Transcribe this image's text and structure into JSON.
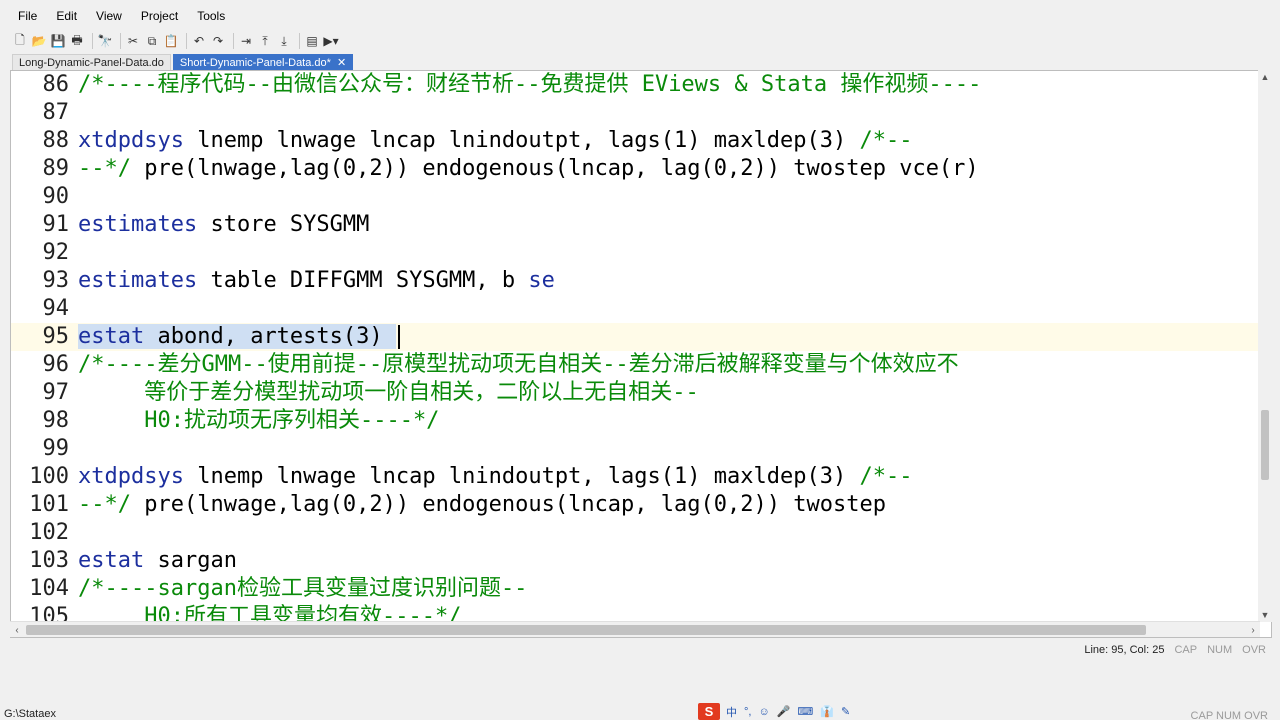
{
  "menu": [
    "File",
    "Edit",
    "View",
    "Project",
    "Tools"
  ],
  "toolbar_icons": [
    "new-file-icon",
    "open-folder-icon",
    "save-icon",
    "print-icon",
    "find-icon",
    "cut-icon",
    "copy-icon",
    "paste-icon",
    "undo-icon",
    "redo-icon",
    "indent-icon",
    "move-up-icon",
    "move-down-icon",
    "run-icon",
    "do-icon"
  ],
  "tabs": [
    {
      "label": "Long-Dynamic-Panel-Data.do",
      "active": false
    },
    {
      "label": "Short-Dynamic-Panel-Data.do*",
      "active": true,
      "close": "✕"
    }
  ],
  "code_lines": [
    {
      "n": "86",
      "text": "/*----程序代码--由微信公众号：财经节析--免费提供 EViews & Stata 操作视频----",
      "cls": "cmt"
    },
    {
      "n": "87",
      "text": ""
    },
    {
      "n": "88",
      "segments": [
        [
          "xtdpdsys",
          "kw"
        ],
        [
          " lnemp lnwage lncap lnindoutpt, lags(1) maxldep(3) ",
          ""
        ],
        [
          "/*--",
          "cmt"
        ]
      ]
    },
    {
      "n": "89",
      "segments": [
        [
          "--*/",
          "cmt"
        ],
        [
          " pre(lnwage,lag(0,2)) endogenous(lncap, lag(0,2)) twostep vce(r)",
          ""
        ]
      ]
    },
    {
      "n": "90",
      "text": ""
    },
    {
      "n": "91",
      "segments": [
        [
          "estimates",
          "kw"
        ],
        [
          " store SYSGMM",
          ""
        ]
      ]
    },
    {
      "n": "92",
      "text": ""
    },
    {
      "n": "93",
      "segments": [
        [
          "estimates",
          "kw"
        ],
        [
          " table DIFFGMM SYSGMM, b ",
          ""
        ],
        [
          "se",
          "kw"
        ]
      ]
    },
    {
      "n": "94",
      "text": ""
    },
    {
      "n": "95",
      "segments": [
        [
          "estat",
          "kw"
        ],
        [
          " abond, artests(3) ",
          ""
        ]
      ],
      "selected": true,
      "current": true
    },
    {
      "n": "96",
      "text": "/*----差分GMM--使用前提--原模型扰动项无自相关--差分滞后被解释变量与个体效应不",
      "cls": "cmt"
    },
    {
      "n": "97",
      "text": "     等价于差分模型扰动项一阶自相关，二阶以上无自相关--",
      "cls": "cmt"
    },
    {
      "n": "98",
      "text": "     H0:扰动项无序列相关----*/",
      "cls": "cmt"
    },
    {
      "n": "99",
      "text": ""
    },
    {
      "n": "100",
      "segments": [
        [
          "xtdpdsys",
          "kw"
        ],
        [
          " lnemp lnwage lncap lnindoutpt, lags(1) maxldep(3) ",
          ""
        ],
        [
          "/*--",
          "cmt"
        ]
      ]
    },
    {
      "n": "101",
      "segments": [
        [
          "--*/",
          "cmt"
        ],
        [
          " pre(lnwage,lag(0,2)) endogenous(lncap, lag(0,2)) twostep",
          ""
        ]
      ]
    },
    {
      "n": "102",
      "text": ""
    },
    {
      "n": "103",
      "segments": [
        [
          "estat",
          "kw"
        ],
        [
          " sargan",
          ""
        ]
      ]
    },
    {
      "n": "104",
      "text": "/*----sargan检验工具变量过度识别问题--",
      "cls": "cmt"
    },
    {
      "n": "105",
      "text": "     H0:所有工具变量均有效----*/",
      "cls": "cmt"
    }
  ],
  "status": {
    "position": "Line: 95, Col: 25",
    "cap": "CAP",
    "num": "NUM",
    "ovr": "OVR"
  },
  "taskbar": {
    "path": "G:\\Stataex",
    "cap": "CAP",
    "num": "NUM",
    "ovr": "OVR"
  },
  "ime": {
    "logo": "S",
    "items": [
      "中",
      "°,",
      "☺",
      "🎤",
      "⌨",
      "👔",
      "✎"
    ]
  },
  "colors": {
    "keyword": "#1c2f9e",
    "comment": "#0a8a0a",
    "selection": "#cfdff3",
    "active_tab": "#3a72c9"
  }
}
